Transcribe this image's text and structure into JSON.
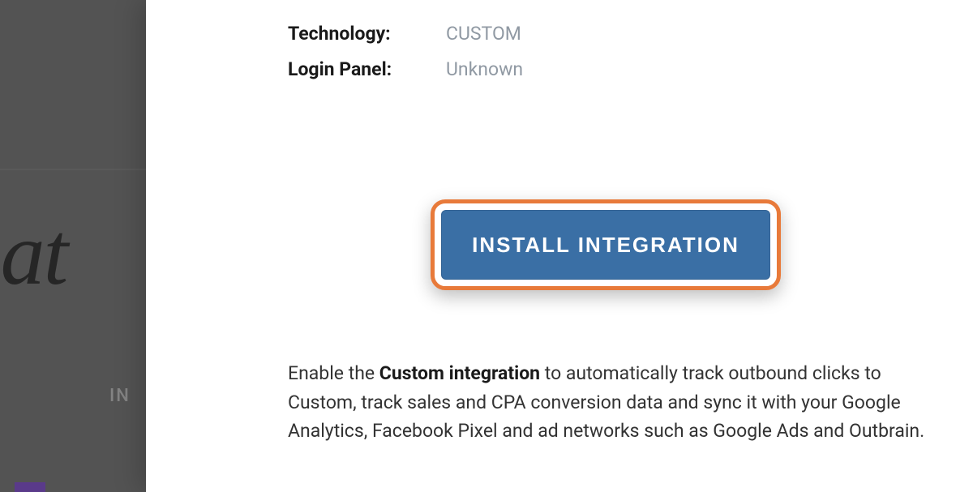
{
  "backdrop": {
    "large_text_fragment": "iliat",
    "small_text_fragment": "IN"
  },
  "details": {
    "technology_label": "Technology:",
    "technology_value": "CUSTOM",
    "login_label": "Login Panel:",
    "login_value": "Unknown"
  },
  "button": {
    "install_label": "INSTALL INTEGRATION"
  },
  "description": {
    "prefix": "Enable the ",
    "bold": "Custom integration",
    "suffix": " to automatically track outbound clicks to Custom, track sales and CPA conversion data and sync it with your Google Analytics, Facebook Pixel and ad networks such as Google Ads and Outbrain."
  }
}
